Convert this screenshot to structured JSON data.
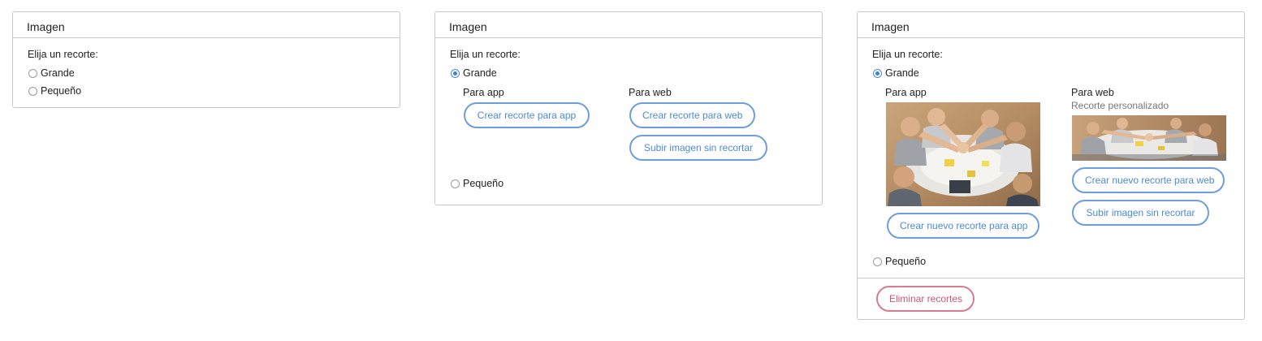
{
  "panels": [
    {
      "title": "Imagen",
      "prompt": "Elija un recorte:",
      "options": {
        "large": "Grande",
        "small": "Pequeño"
      }
    },
    {
      "title": "Imagen",
      "prompt": "Elija un recorte:",
      "options": {
        "large": "Grande",
        "small": "Pequeño"
      },
      "selected": "Grande",
      "app_column": {
        "title": "Para app",
        "create_button": "Crear recorte para app"
      },
      "web_column": {
        "title": "Para web",
        "create_button": "Crear recorte para web",
        "upload_button": "Subir imagen sin recortar"
      }
    },
    {
      "title": "Imagen",
      "prompt": "Elija un recorte:",
      "options": {
        "large": "Grande",
        "small": "Pequeño"
      },
      "selected": "Grande",
      "app_column": {
        "title": "Para app",
        "create_new_button": "Crear nuevo recorte para app"
      },
      "web_column": {
        "title": "Para web",
        "subtitle": "Recorte personalizado",
        "create_new_button": "Crear nuevo recorte para web",
        "upload_button": "Subir imagen sin recortar"
      },
      "delete_button": "Eliminar recortes"
    }
  ],
  "colors": {
    "accent": "#4d8ad4",
    "danger": "#cc5577",
    "border": "#c9c9c9"
  }
}
